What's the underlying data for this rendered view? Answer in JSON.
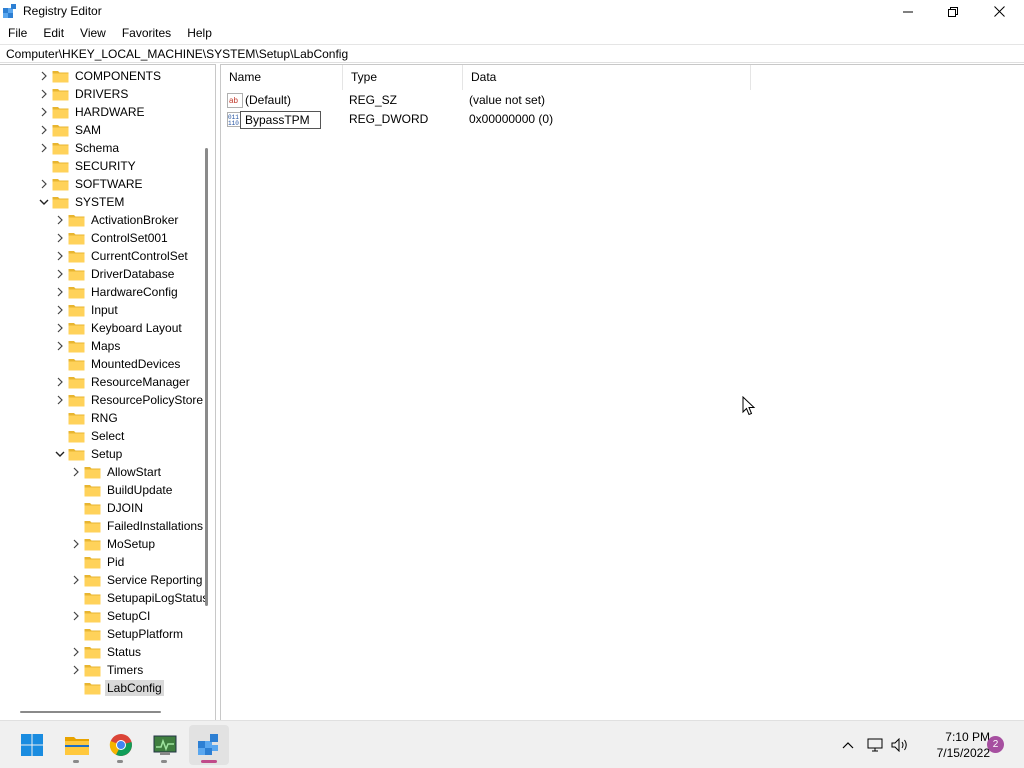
{
  "window": {
    "title": "Registry Editor",
    "icons": {
      "app": "registry-icon",
      "minimize": "minimize-icon",
      "maximize": "restore-icon",
      "close": "close-icon"
    }
  },
  "menu": {
    "items": [
      "File",
      "Edit",
      "View",
      "Favorites",
      "Help"
    ]
  },
  "address": {
    "path": "Computer\\HKEY_LOCAL_MACHINE\\SYSTEM\\Setup\\LabConfig"
  },
  "tree": {
    "items": [
      {
        "label": "COMPONENTS",
        "level": 1,
        "expander": "collapsed"
      },
      {
        "label": "DRIVERS",
        "level": 1,
        "expander": "collapsed"
      },
      {
        "label": "HARDWARE",
        "level": 1,
        "expander": "collapsed"
      },
      {
        "label": "SAM",
        "level": 1,
        "expander": "collapsed"
      },
      {
        "label": "Schema",
        "level": 1,
        "expander": "collapsed"
      },
      {
        "label": "SECURITY",
        "level": 1,
        "expander": "none"
      },
      {
        "label": "SOFTWARE",
        "level": 1,
        "expander": "collapsed"
      },
      {
        "label": "SYSTEM",
        "level": 1,
        "expander": "expanded"
      },
      {
        "label": "ActivationBroker",
        "level": 2,
        "expander": "collapsed"
      },
      {
        "label": "ControlSet001",
        "level": 2,
        "expander": "collapsed"
      },
      {
        "label": "CurrentControlSet",
        "level": 2,
        "expander": "collapsed"
      },
      {
        "label": "DriverDatabase",
        "level": 2,
        "expander": "collapsed"
      },
      {
        "label": "HardwareConfig",
        "level": 2,
        "expander": "collapsed"
      },
      {
        "label": "Input",
        "level": 2,
        "expander": "collapsed"
      },
      {
        "label": "Keyboard Layout",
        "level": 2,
        "expander": "collapsed"
      },
      {
        "label": "Maps",
        "level": 2,
        "expander": "collapsed"
      },
      {
        "label": "MountedDevices",
        "level": 2,
        "expander": "none"
      },
      {
        "label": "ResourceManager",
        "level": 2,
        "expander": "collapsed"
      },
      {
        "label": "ResourcePolicyStore",
        "level": 2,
        "expander": "collapsed"
      },
      {
        "label": "RNG",
        "level": 2,
        "expander": "none"
      },
      {
        "label": "Select",
        "level": 2,
        "expander": "none"
      },
      {
        "label": "Setup",
        "level": 2,
        "expander": "expanded"
      },
      {
        "label": "AllowStart",
        "level": 3,
        "expander": "collapsed"
      },
      {
        "label": "BuildUpdate",
        "level": 3,
        "expander": "none"
      },
      {
        "label": "DJOIN",
        "level": 3,
        "expander": "none"
      },
      {
        "label": "FailedInstallations",
        "level": 3,
        "expander": "none"
      },
      {
        "label": "MoSetup",
        "level": 3,
        "expander": "collapsed"
      },
      {
        "label": "Pid",
        "level": 3,
        "expander": "none"
      },
      {
        "label": "Service Reporting",
        "level": 3,
        "expander": "collapsed"
      },
      {
        "label": "SetupapiLogStatus",
        "level": 3,
        "expander": "none"
      },
      {
        "label": "SetupCI",
        "level": 3,
        "expander": "collapsed"
      },
      {
        "label": "SetupPlatform",
        "level": 3,
        "expander": "none"
      },
      {
        "label": "Status",
        "level": 3,
        "expander": "collapsed"
      },
      {
        "label": "Timers",
        "level": 3,
        "expander": "collapsed"
      },
      {
        "label": "LabConfig",
        "level": 3,
        "expander": "none",
        "selected": true
      }
    ]
  },
  "list": {
    "columns": [
      "Name",
      "Type",
      "Data"
    ],
    "rows": [
      {
        "name": "(Default)",
        "type": "REG_SZ",
        "data": "(value not set)",
        "icon": "string-value-icon",
        "editing": false
      },
      {
        "name": "BypassTPM",
        "type": "REG_DWORD",
        "data": "0x00000000 (0)",
        "icon": "binary-value-icon",
        "editing": true
      }
    ]
  },
  "taskbar": {
    "apps": [
      {
        "name": "start-button",
        "icon": "windows-logo-icon"
      },
      {
        "name": "file-explorer",
        "icon": "folder-icon"
      },
      {
        "name": "chrome",
        "icon": "chrome-icon"
      },
      {
        "name": "task-manager",
        "icon": "task-manager-icon"
      },
      {
        "name": "registry-editor",
        "icon": "registry-icon",
        "active": true
      }
    ],
    "tray": [
      "chevron-up-icon",
      "network-icon",
      "volume-icon"
    ],
    "time": "7:10 PM",
    "date": "7/15/2022",
    "notifications": "2"
  }
}
